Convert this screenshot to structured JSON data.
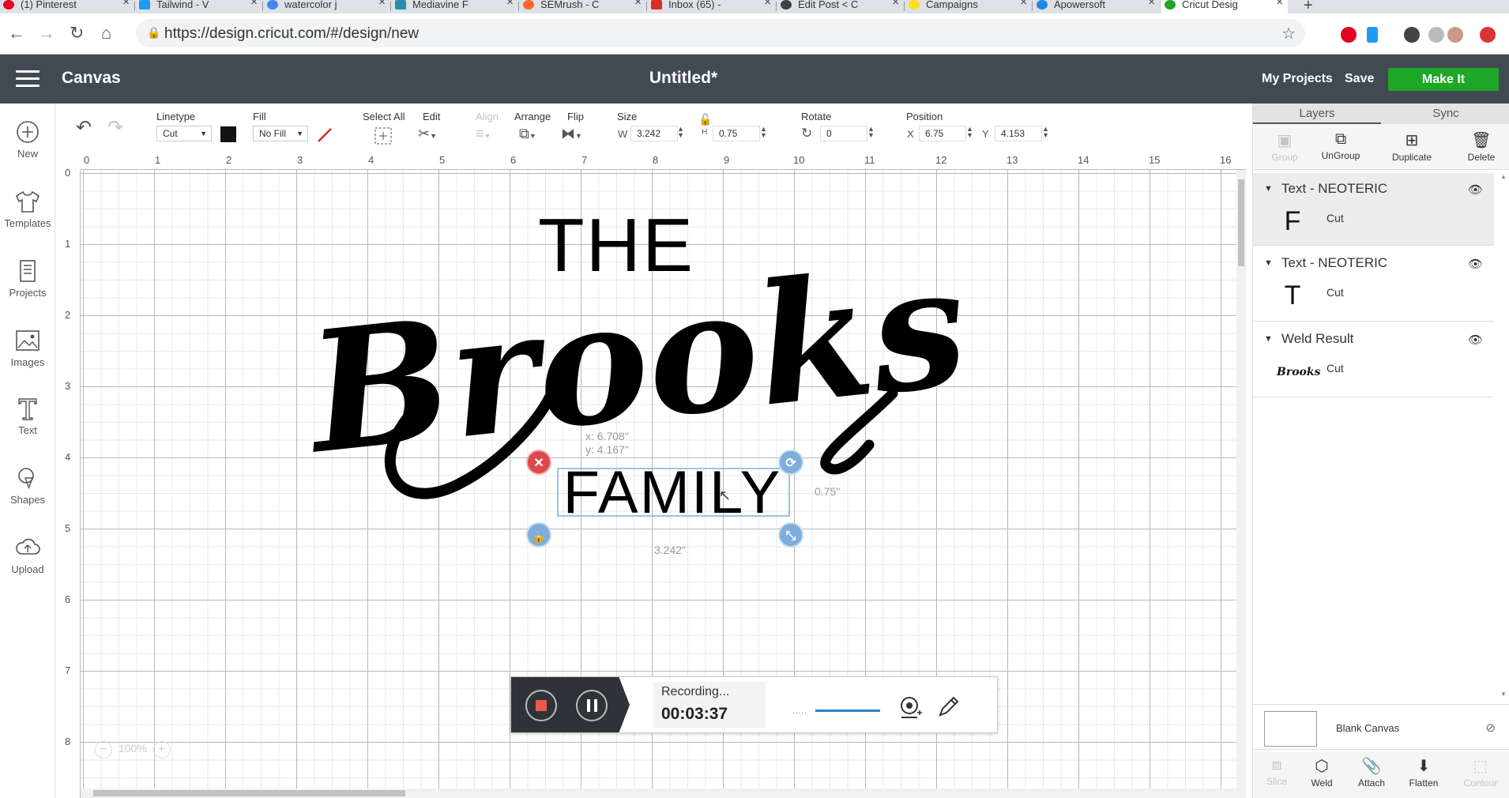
{
  "browser": {
    "tabs": [
      {
        "title": "(1) Pinterest",
        "color": "#e60023"
      },
      {
        "title": "Tailwind - V",
        "color": "#1d9bf0"
      },
      {
        "title": "watercolor j",
        "color": "#4285f4"
      },
      {
        "title": "Mediavine F",
        "color": "#2a8fa8"
      },
      {
        "title": "SEMrush - C",
        "color": "#ff642d"
      },
      {
        "title": "Inbox (65) -",
        "color": "#d93025"
      },
      {
        "title": "Edit Post < C",
        "color": "#3c434a"
      },
      {
        "title": "Campaigns",
        "color": "#ffe01b"
      },
      {
        "title": "Apowersoft",
        "color": "#1e88e5"
      },
      {
        "title": "Cricut Desig",
        "color": "#1fa728"
      }
    ],
    "new_tab": "+",
    "url": "https://design.cricut.com/#/design/new"
  },
  "header": {
    "app_name": "Canvas",
    "doc_title": "Untitled*",
    "my_projects": "My Projects",
    "save": "Save",
    "make_it": "Make It"
  },
  "sidebar": {
    "items": [
      {
        "label": "New"
      },
      {
        "label": "Templates"
      },
      {
        "label": "Projects"
      },
      {
        "label": "Images"
      },
      {
        "label": "Text"
      },
      {
        "label": "Shapes"
      },
      {
        "label": "Upload"
      }
    ]
  },
  "toolbar": {
    "linetype_label": "Linetype",
    "linetype_value": "Cut",
    "fill_label": "Fill",
    "fill_value": "No Fill",
    "select_all": "Select All",
    "edit": "Edit",
    "align": "Align",
    "arrange": "Arrange",
    "flip": "Flip",
    "size_label": "Size",
    "w_label": "W",
    "w_value": "3.242",
    "h_label": "H",
    "h_value": "0.75",
    "rotate_label": "Rotate",
    "rotate_value": "0",
    "position_label": "Position",
    "x_label": "X",
    "x_value": "6.75",
    "y_label": "Y",
    "y_value": "4.153"
  },
  "ruler": {
    "top": [
      "0",
      "1",
      "2",
      "3",
      "4",
      "5",
      "6",
      "7",
      "8",
      "9",
      "10",
      "11",
      "12",
      "13",
      "14",
      "15",
      "16"
    ],
    "left": [
      "0",
      "1",
      "2",
      "3",
      "4",
      "5",
      "6",
      "7",
      "8"
    ]
  },
  "canvas": {
    "design": {
      "line1": "THE",
      "line2": "Brooks",
      "line3": "FAMILY"
    },
    "coord_x": "x: 6.708\"",
    "coord_y": "y: 4.167\"",
    "height_dim": "0.75\"",
    "width_dim": "3.242\"",
    "zoom": "100%"
  },
  "recorder": {
    "status": "Recording...",
    "time": "00:03:37",
    "level": 0.6
  },
  "layers_panel": {
    "tab_layers": "Layers",
    "tab_sync": "Sync",
    "actions": [
      "Group",
      "UnGroup",
      "Duplicate",
      "Delete"
    ],
    "layers": [
      {
        "name": "Text - NEOTERIC",
        "glyph": "F",
        "op": "Cut"
      },
      {
        "name": "Text - NEOTERIC",
        "glyph": "T",
        "op": "Cut"
      },
      {
        "name": "Weld Result",
        "glyph": "Brooks",
        "op": "Cut"
      }
    ],
    "blank_canvas": "Blank Canvas",
    "bottom_actions": [
      "Slice",
      "Weld",
      "Attach",
      "Flatten",
      "Contour"
    ]
  }
}
